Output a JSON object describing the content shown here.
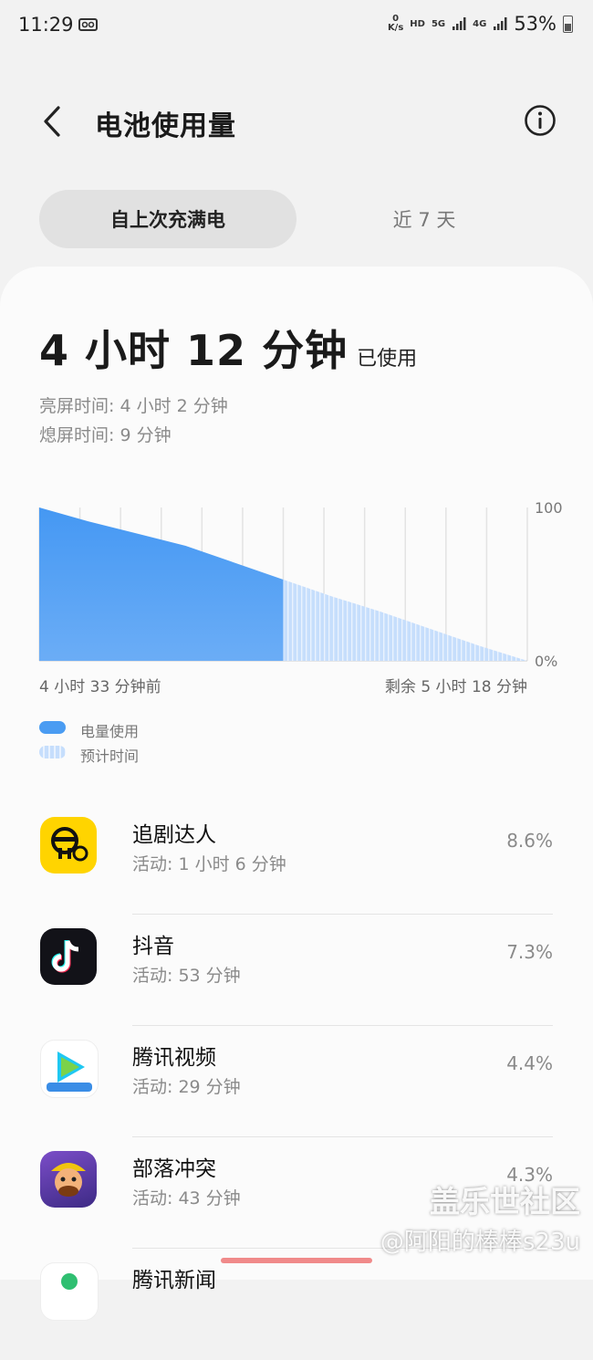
{
  "status_bar": {
    "time": "11:29",
    "net_speed_value": "0",
    "net_speed_unit": "K/s",
    "hd": "HD",
    "sim1": "5G",
    "sim2": "4G",
    "battery": "53%"
  },
  "header": {
    "title": "电池使用量"
  },
  "tabs": [
    {
      "label": "自上次充满电",
      "active": true
    },
    {
      "label": "近 7 天",
      "active": false
    }
  ],
  "usage": {
    "total": "4 小时 12 分钟",
    "total_suffix": "已使用",
    "screen_on": "亮屏时间:  4 小时 2 分钟",
    "screen_off": "熄屏时间:  9 分钟"
  },
  "chart_data": {
    "type": "area",
    "ylim": [
      0,
      100
    ],
    "y_tick_labels": [
      "100",
      "0%"
    ],
    "x_start_label": "4 小时 33 分钟前",
    "x_end_label": "剩余 5 小时 18 分钟",
    "series": [
      {
        "name": "电量使用",
        "color": "#4a9cf2",
        "x": [
          0,
          0.1,
          0.2,
          0.3,
          0.4,
          0.5
        ],
        "values": [
          100,
          91,
          83,
          75,
          64,
          53
        ]
      },
      {
        "name": "预计时间",
        "color": "#b9d7fb",
        "x": [
          0.5,
          0.6,
          0.7,
          0.8,
          0.9,
          1.0
        ],
        "values": [
          53,
          42,
          32,
          21,
          10,
          0
        ]
      }
    ],
    "grid": true
  },
  "legend": [
    {
      "label": "电量使用",
      "color": "#4a9cf2"
    },
    {
      "label": "预计时间",
      "color": "#cfe3fb"
    }
  ],
  "apps": [
    {
      "name": "追剧达人",
      "activity": "活动:  1 小时 6 分钟",
      "percent": "8.6%",
      "icon": "zhuiju-app-icon"
    },
    {
      "name": "抖音",
      "activity": "活动:  53 分钟",
      "percent": "7.3%",
      "icon": "douyin-app-icon"
    },
    {
      "name": "腾讯视频",
      "activity": "活动:  29 分钟",
      "percent": "4.4%",
      "icon": "tencent-video-app-icon"
    },
    {
      "name": "部落冲突",
      "activity": "活动:  43 分钟",
      "percent": "4.3%",
      "icon": "clash-of-clans-app-icon"
    },
    {
      "name": "腾讯新闻",
      "activity": "",
      "percent": "",
      "icon": "tencent-news-app-icon"
    }
  ],
  "watermark": {
    "line1": "盖乐世社区",
    "line2": "@阿阳的棒棒s23u"
  }
}
